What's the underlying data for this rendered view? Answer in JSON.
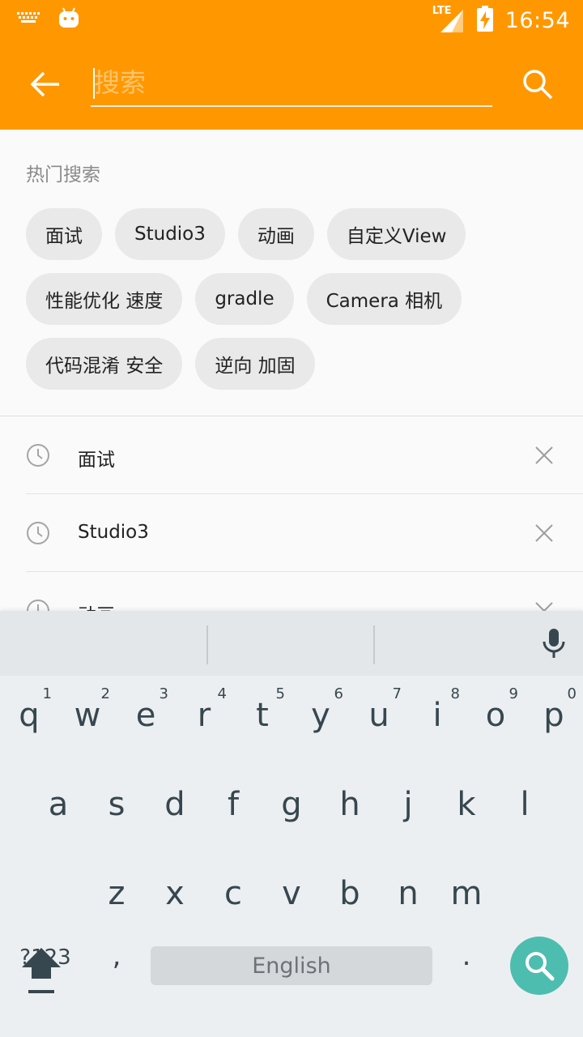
{
  "status_bar": {
    "network": "LTE",
    "time": "16:54"
  },
  "search": {
    "placeholder": "搜索"
  },
  "hot": {
    "title": "热门搜索",
    "tags": [
      "面试",
      "Studio3",
      "动画",
      "自定义View",
      "性能优化 速度",
      "gradle",
      "Camera 相机",
      "代码混淆 安全",
      "逆向 加固"
    ]
  },
  "history": [
    {
      "label": "面试"
    },
    {
      "label": "Studio3"
    },
    {
      "label": "动画"
    }
  ],
  "keyboard": {
    "row1": [
      {
        "k": "q",
        "n": "1"
      },
      {
        "k": "w",
        "n": "2"
      },
      {
        "k": "e",
        "n": "3"
      },
      {
        "k": "r",
        "n": "4"
      },
      {
        "k": "t",
        "n": "5"
      },
      {
        "k": "y",
        "n": "6"
      },
      {
        "k": "u",
        "n": "7"
      },
      {
        "k": "i",
        "n": "8"
      },
      {
        "k": "o",
        "n": "9"
      },
      {
        "k": "p",
        "n": "0"
      }
    ],
    "row2": [
      "a",
      "s",
      "d",
      "f",
      "g",
      "h",
      "j",
      "k",
      "l"
    ],
    "row3": [
      "z",
      "x",
      "c",
      "v",
      "b",
      "n",
      "m"
    ],
    "symbols_label": "?123",
    "comma": ",",
    "period": ".",
    "space_label": "English"
  },
  "colors": {
    "primary": "#ff9800",
    "fab": "#4dbdb0"
  }
}
